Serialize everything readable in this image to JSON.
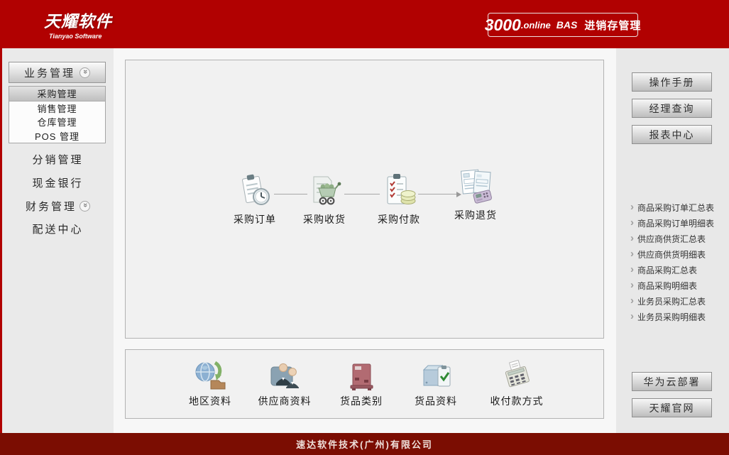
{
  "brand": {
    "logo_title": "天耀软件",
    "logo_subtitle": "Tianyao Software",
    "header_color": "#b10101",
    "footer_color": "#7b0d02"
  },
  "header_badge": {
    "number": "3000",
    "domain": ".online",
    "code": "BAS",
    "product": "进销存管理"
  },
  "sidebar": {
    "group_button": {
      "label": "业务管理",
      "icon": "double-chevron-down-icon"
    },
    "submenu": [
      {
        "label": "采购管理",
        "selected": true
      },
      {
        "label": "销售管理",
        "selected": false
      },
      {
        "label": "仓库管理",
        "selected": false
      },
      {
        "label": "POS 管理",
        "selected": false
      }
    ],
    "items": [
      {
        "label": "分销管理"
      },
      {
        "label": "现金银行"
      },
      {
        "label": "财务管理",
        "icon": "double-chevron-down-icon"
      },
      {
        "label": "配送中心"
      }
    ]
  },
  "workflow": {
    "steps": [
      {
        "label": "采购订单",
        "icon": "clipboard-clock-icon"
      },
      {
        "label": "采购收货",
        "icon": "document-cart-icon"
      },
      {
        "label": "采购付款",
        "icon": "clipboard-coins-icon"
      },
      {
        "label": "采购退货",
        "icon": "invoice-pos-icon"
      }
    ]
  },
  "base_data": {
    "items": [
      {
        "label": "地区资料",
        "icon": "globe-folder-icon"
      },
      {
        "label": "供应商资料",
        "icon": "suppliers-people-icon"
      },
      {
        "label": "货品类别",
        "icon": "category-box-icon"
      },
      {
        "label": "货品资料",
        "icon": "goods-checklist-icon"
      },
      {
        "label": "收付款方式",
        "icon": "calculator-icon"
      }
    ]
  },
  "right_panel": {
    "top_buttons": [
      {
        "label": "操作手册"
      },
      {
        "label": "经理查询"
      },
      {
        "label": "报表中心"
      }
    ],
    "reports": [
      {
        "label": "商品采购订单汇总表"
      },
      {
        "label": "商品采购订单明细表"
      },
      {
        "label": "供应商供货汇总表"
      },
      {
        "label": "供应商供货明细表"
      },
      {
        "label": "商品采购汇总表"
      },
      {
        "label": "商品采购明细表"
      },
      {
        "label": "业务员采购汇总表"
      },
      {
        "label": "业务员采购明细表"
      }
    ],
    "bottom_buttons": [
      {
        "label": "华为云部署"
      },
      {
        "label": "天耀官网"
      }
    ]
  },
  "footer": {
    "company": "速达软件技术(广州)有限公司"
  }
}
